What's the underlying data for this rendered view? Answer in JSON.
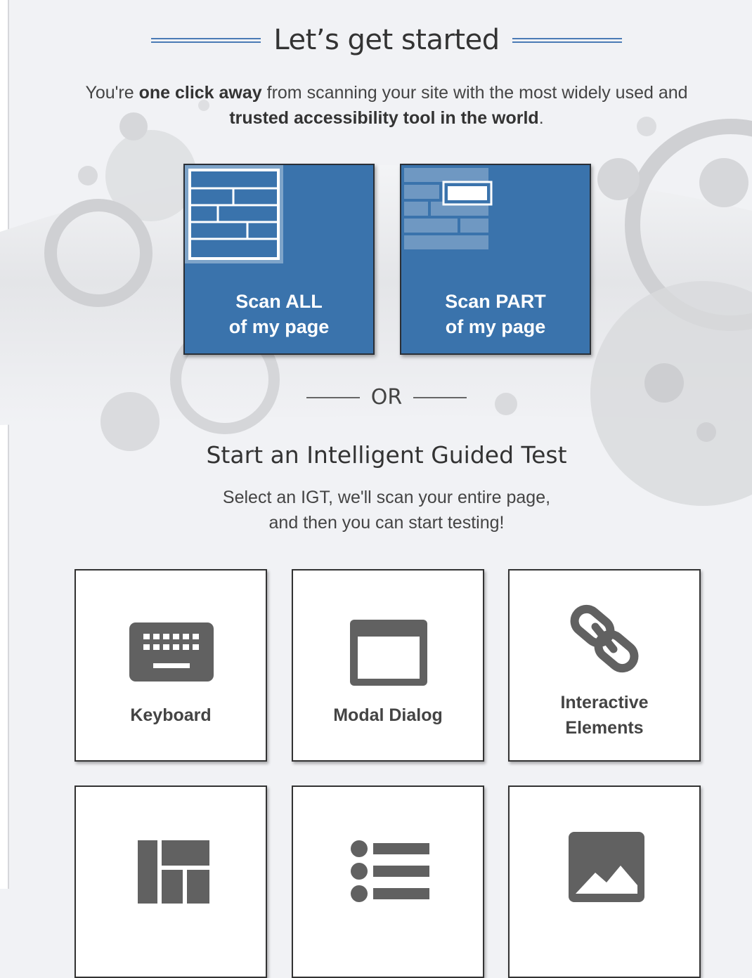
{
  "heading": {
    "title": "Let’s get started"
  },
  "intro": {
    "part1": "You're ",
    "bold1": "one click away",
    "part2": " from scanning your site with the most widely used and ",
    "bold2": "trusted accessibility tool in the world",
    "part3": "."
  },
  "scan_all": {
    "line1": "Scan ALL",
    "line2": "of my page",
    "icon": "full-page-wireframe-icon"
  },
  "scan_part": {
    "line1": "Scan PART",
    "line2": "of my page",
    "icon": "partial-page-wireframe-icon"
  },
  "or_text": "OR",
  "igt": {
    "title": "Start an Intelligent Guided Test",
    "subtitle_line1": "Select an IGT, we'll scan your entire page,",
    "subtitle_line2": "and then you can start testing!",
    "tiles": [
      {
        "label": "Keyboard",
        "icon": "keyboard-icon"
      },
      {
        "label": "Modal Dialog",
        "icon": "modal-dialog-icon"
      },
      {
        "label_line1": "Interactive",
        "label_line2": "Elements",
        "icon": "link-chain-icon"
      },
      {
        "icon": "table-layout-icon"
      },
      {
        "icon": "bulleted-list-icon"
      },
      {
        "icon": "image-icon"
      }
    ]
  },
  "colors": {
    "accent_blue": "#3a73ac",
    "heading_rule_blue": "#4a7bb5",
    "background": "#f1f2f5",
    "icon_gray": "#616161"
  }
}
